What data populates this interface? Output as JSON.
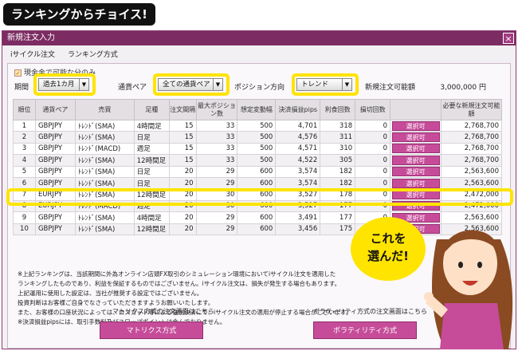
{
  "banner": {
    "title": "ランキングからチョイス!"
  },
  "window": {
    "title": "新規注文入力",
    "close": "×"
  },
  "tabs": [
    {
      "label": "iサイクル注文"
    },
    {
      "label": "ランキング方式"
    }
  ],
  "checkbox": {
    "label": "現金金で可能な分のみ"
  },
  "filters": {
    "period_label": "期間",
    "period_value": "過去1カ月",
    "pair_label": "通貨ペア",
    "pair_value": "全ての通貨ペア",
    "direction_label": "ポジション方向",
    "direction_value": "トレンド",
    "amount_label": "新規注文可能額",
    "amount_value": "3,000,000 円"
  },
  "table": {
    "headers": [
      "順位",
      "通貨ペア",
      "売買",
      "足種",
      "注文間隔",
      "最大ポジション数",
      "想定変動幅",
      "決済損益pips",
      "利食回数",
      "損切回数",
      "",
      "必要な新規注文可能額"
    ],
    "button_label": "選択可",
    "rows": [
      [
        "1",
        "GBPJPY",
        "ﾄﾚﾝﾄﾞ(SMA)",
        "4時間足",
        "15",
        "33",
        "500",
        "4,701",
        "318",
        "0",
        "2,768,700"
      ],
      [
        "2",
        "GBPJPY",
        "ﾄﾚﾝﾄﾞ(SMA)",
        "日足",
        "15",
        "33",
        "500",
        "4,576",
        "311",
        "0",
        "2,768,700"
      ],
      [
        "3",
        "GBPJPY",
        "ﾄﾚﾝﾄﾞ(MACD)",
        "週足",
        "15",
        "33",
        "500",
        "4,571",
        "310",
        "0",
        "2,768,700"
      ],
      [
        "4",
        "GBPJPY",
        "ﾄﾚﾝﾄﾞ(SMA)",
        "12時間足",
        "15",
        "33",
        "500",
        "4,522",
        "305",
        "0",
        "2,768,700"
      ],
      [
        "5",
        "GBPJPY",
        "ﾄﾚﾝﾄﾞ(SMA)",
        "日足",
        "20",
        "29",
        "600",
        "3,574",
        "182",
        "0",
        "2,563,600"
      ],
      [
        "6",
        "GBPJPY",
        "ﾄﾚﾝﾄﾞ(SMA)",
        "日足",
        "20",
        "29",
        "600",
        "3,574",
        "182",
        "0",
        "2,563,600"
      ],
      [
        "7",
        "EURJPY",
        "ﾄﾚﾝﾄﾞ(SMA)",
        "12時間足",
        "20",
        "30",
        "600",
        "3,527",
        "178",
        "0",
        "2,472,000"
      ],
      [
        "8",
        "EURJPY",
        "ﾄﾚﾝﾄﾞ(MACD)",
        "週足",
        "20",
        "30",
        "600",
        "3,527",
        "177",
        "0",
        "2,472,000"
      ],
      [
        "9",
        "GBPJPY",
        "ﾄﾚﾝﾄﾞ(SMA)",
        "4時間足",
        "20",
        "29",
        "600",
        "3,491",
        "177",
        "0",
        "2,563,600"
      ],
      [
        "10",
        "GBPJPY",
        "ﾄﾚﾝﾄﾞ(SMA)",
        "12時間足",
        "20",
        "29",
        "600",
        "3,456",
        "175",
        "0",
        "2,563,600"
      ]
    ]
  },
  "notes": [
    "※上記ランキングは、当該期間に外為オンライン店頭FX取引のシミュレーション環境においてiサイクル注文を適用した",
    "ランキングしたものであり、利益を保証するものではございません。iサイクル注文は、損失が発生する場合もあります。",
    "上記運用に使用した設定は、当社が推奨する設定ではございません。",
    "投資判断はお客様ご自身でなさっていただきますようお願いいたします。",
    "また、お客様の口座状況によっては、ロスカット等による強制決済にて、iサイクル注文の適用が停止する場合がございます。",
    "※決済損益pipsには、取引手数料及びスワップポイントは含んでおりません。"
  ],
  "bottom": {
    "matrix_label": "マトリクス方式の注文画面はこちら",
    "matrix_button": "マトリクス方式",
    "volatility_label": "ボラティリティ方式の注文画面はこちら",
    "volatility_button": "ボラティリティ方式"
  },
  "callout": {
    "line1": "これを",
    "line2": "選んだ!"
  },
  "colors": {
    "accent": "#c64c9a",
    "titlebar": "#7d2c63",
    "highlight": "#ffe400"
  }
}
